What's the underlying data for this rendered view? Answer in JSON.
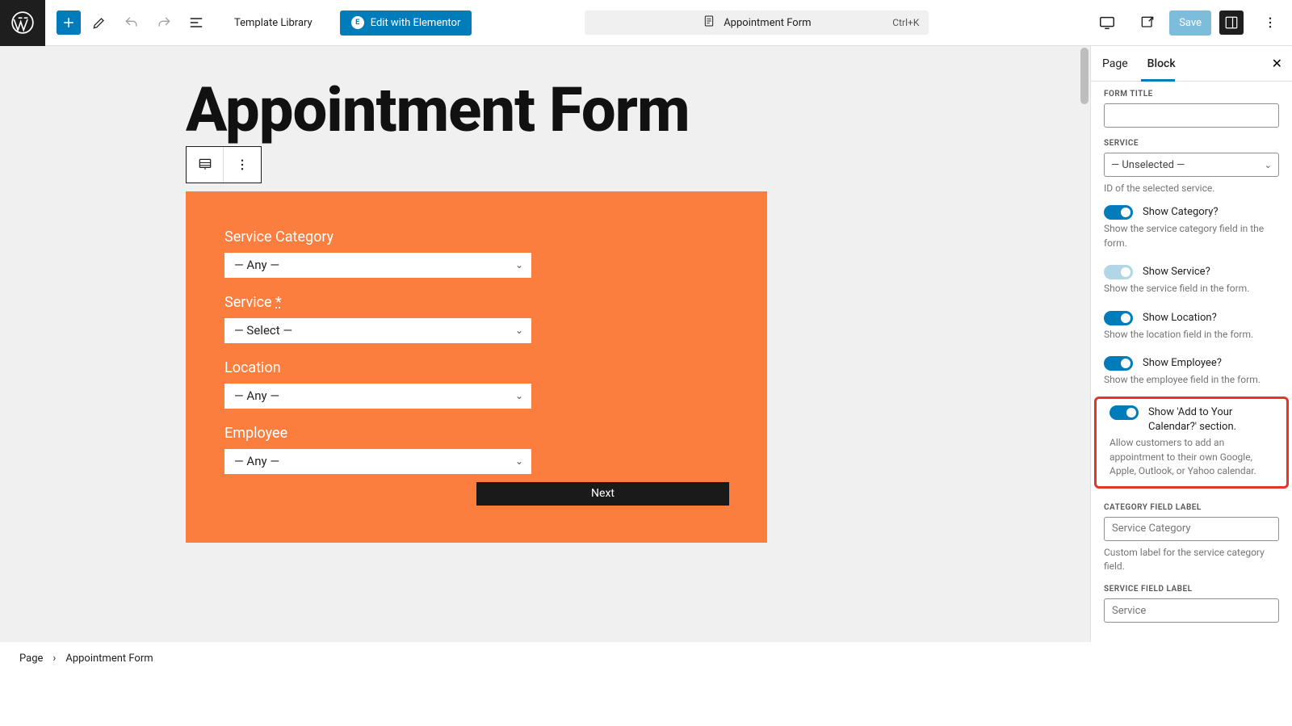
{
  "topbar": {
    "template_library": "Template Library",
    "edit_elementor": "Edit with Elementor",
    "title": "Appointment Form",
    "shortcut": "Ctrl+K",
    "save": "Save"
  },
  "canvas": {
    "page_title": "Appointment Form",
    "form": {
      "category_label": "Service Category",
      "category_value": "— Any —",
      "service_label": "Service",
      "service_value": "— Select —",
      "location_label": "Location",
      "location_value": "— Any —",
      "employee_label": "Employee",
      "employee_value": "— Any —",
      "next": "Next"
    }
  },
  "sidebar": {
    "tabs": {
      "page": "Page",
      "block": "Block"
    },
    "form_title_label": "FORM TITLE",
    "service_label": "SERVICE",
    "service_value": "— Unselected —",
    "service_help": "ID of the selected service.",
    "toggles": {
      "show_category": "Show Category?",
      "show_category_help": "Show the service category field in the form.",
      "show_service": "Show Service?",
      "show_service_help": "Show the service field in the form.",
      "show_location": "Show Location?",
      "show_location_help": "Show the location field in the form.",
      "show_employee": "Show Employee?",
      "show_employee_help": "Show the employee field in the form.",
      "show_calendar": "Show 'Add to Your Calendar?' section.",
      "show_calendar_help": "Allow customers to add an appointment to their own Google, Apple, Outlook, or Yahoo calendar."
    },
    "category_field_label": "CATEGORY FIELD LABEL",
    "category_field_placeholder": "Service Category",
    "category_field_help": "Custom label for the service category field.",
    "service_field_label": "SERVICE FIELD LABEL",
    "service_field_placeholder": "Service"
  },
  "footer": {
    "page": "Page",
    "current": "Appointment Form"
  }
}
